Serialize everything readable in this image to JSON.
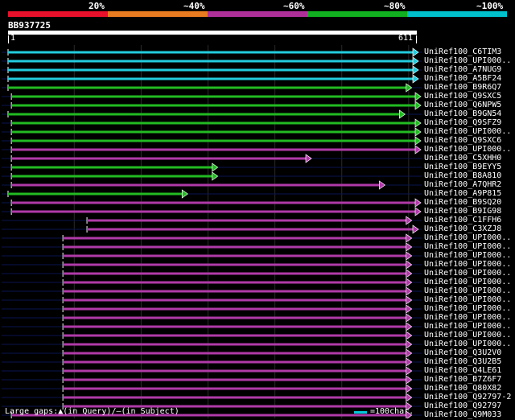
{
  "scale": {
    "labels": [
      "20%",
      "~40%",
      "~60%",
      "~80%",
      "~100%"
    ],
    "segment_colors": [
      "#e8102a",
      "#e87a20",
      "#b0309a",
      "#10b020",
      "#00c0cc"
    ]
  },
  "query": {
    "name": "BB937725",
    "start_label": "1",
    "end_label": "611",
    "length": 611
  },
  "colors": {
    "cyan": "#22ccdd",
    "green": "#22bb22",
    "purple": "#b03aa8",
    "track": "#0a1450",
    "grid": "#2a2a2a"
  },
  "hits": [
    {
      "name": "UniRef100_C6TIM3",
      "start": 1,
      "end": 611,
      "color": "cyan"
    },
    {
      "name": "UniRef100_UPI000..",
      "start": 1,
      "end": 611,
      "color": "cyan"
    },
    {
      "name": "UniRef100_A7NUG9",
      "start": 1,
      "end": 611,
      "color": "cyan"
    },
    {
      "name": "UniRef100_A5BF24",
      "start": 1,
      "end": 611,
      "color": "cyan"
    },
    {
      "name": "UniRef100_B9R6Q7",
      "start": 1,
      "end": 601,
      "color": "green"
    },
    {
      "name": "UniRef100_Q9SXC5",
      "start": 6,
      "end": 616,
      "color": "green"
    },
    {
      "name": "UniRef100_Q6NPW5",
      "start": 6,
      "end": 616,
      "color": "green"
    },
    {
      "name": "UniRef100_B9GN54",
      "start": 1,
      "end": 591,
      "color": "green"
    },
    {
      "name": "UniRef100_Q9SFZ9",
      "start": 6,
      "end": 616,
      "color": "green"
    },
    {
      "name": "UniRef100_UPI000..",
      "start": 6,
      "end": 620,
      "color": "green"
    },
    {
      "name": "UniRef100_Q9SXC6",
      "start": 6,
      "end": 620,
      "color": "green"
    },
    {
      "name": "UniRef100_UPI000..",
      "start": 6,
      "end": 620,
      "color": "purple"
    },
    {
      "name": "UniRef100_C5XHH0",
      "start": 6,
      "end": 451,
      "color": "purple"
    },
    {
      "name": "UniRef100_B9EYY5",
      "start": 6,
      "end": 311,
      "color": "green"
    },
    {
      "name": "UniRef100_B8A810",
      "start": 6,
      "end": 311,
      "color": "green"
    },
    {
      "name": "UniRef100_A7QHR2",
      "start": 6,
      "end": 561,
      "color": "purple"
    },
    {
      "name": "UniRef100_A9P815",
      "start": 1,
      "end": 266,
      "color": "green"
    },
    {
      "name": "UniRef100_B9SQ20",
      "start": 6,
      "end": 620,
      "color": "purple"
    },
    {
      "name": "UniRef100_B9IG98",
      "start": 6,
      "end": 633,
      "color": "purple"
    },
    {
      "name": "UniRef100_C1FFH6",
      "start": 119,
      "end": 601,
      "color": "purple"
    },
    {
      "name": "UniRef100_C3XZJ8",
      "start": 119,
      "end": 611,
      "color": "purple"
    },
    {
      "name": "UniRef100_UPI000..",
      "start": 83,
      "end": 601,
      "color": "purple"
    },
    {
      "name": "UniRef100_UPI000..",
      "start": 83,
      "end": 601,
      "color": "purple"
    },
    {
      "name": "UniRef100_UPI000..",
      "start": 83,
      "end": 601,
      "color": "purple"
    },
    {
      "name": "UniRef100_UPI000..",
      "start": 83,
      "end": 601,
      "color": "purple"
    },
    {
      "name": "UniRef100_UPI000..",
      "start": 83,
      "end": 601,
      "color": "purple"
    },
    {
      "name": "UniRef100_UPI000..",
      "start": 83,
      "end": 601,
      "color": "purple"
    },
    {
      "name": "UniRef100_UPI000..",
      "start": 83,
      "end": 601,
      "color": "purple"
    },
    {
      "name": "UniRef100_UPI000..",
      "start": 83,
      "end": 601,
      "color": "purple"
    },
    {
      "name": "UniRef100_UPI000..",
      "start": 83,
      "end": 601,
      "color": "purple"
    },
    {
      "name": "UniRef100_UPI000..",
      "start": 83,
      "end": 601,
      "color": "purple"
    },
    {
      "name": "UniRef100_UPI000..",
      "start": 83,
      "end": 601,
      "color": "purple"
    },
    {
      "name": "UniRef100_UPI000..",
      "start": 83,
      "end": 601,
      "color": "purple"
    },
    {
      "name": "UniRef100_UPI000..",
      "start": 83,
      "end": 601,
      "color": "purple"
    },
    {
      "name": "UniRef100_Q3U2V0",
      "start": 83,
      "end": 601,
      "color": "purple"
    },
    {
      "name": "UniRef100_Q3U2B5",
      "start": 83,
      "end": 601,
      "color": "purple"
    },
    {
      "name": "UniRef100_Q4LE61",
      "start": 83,
      "end": 601,
      "color": "purple"
    },
    {
      "name": "UniRef100_B7Z6F7",
      "start": 83,
      "end": 601,
      "color": "purple"
    },
    {
      "name": "UniRef100_Q80X82",
      "start": 83,
      "end": 601,
      "color": "purple"
    },
    {
      "name": "UniRef100_Q92797-2",
      "start": 83,
      "end": 601,
      "color": "purple"
    },
    {
      "name": "UniRef100_Q92797",
      "start": 83,
      "end": 601,
      "color": "purple"
    },
    {
      "name": "UniRef100_Q9M033",
      "start": 6,
      "end": 601,
      "color": "purple"
    }
  ],
  "legend": {
    "gaps_text": "Large gaps:▲(in Query)/–(in Subject)",
    "scale_text": "=100char."
  }
}
